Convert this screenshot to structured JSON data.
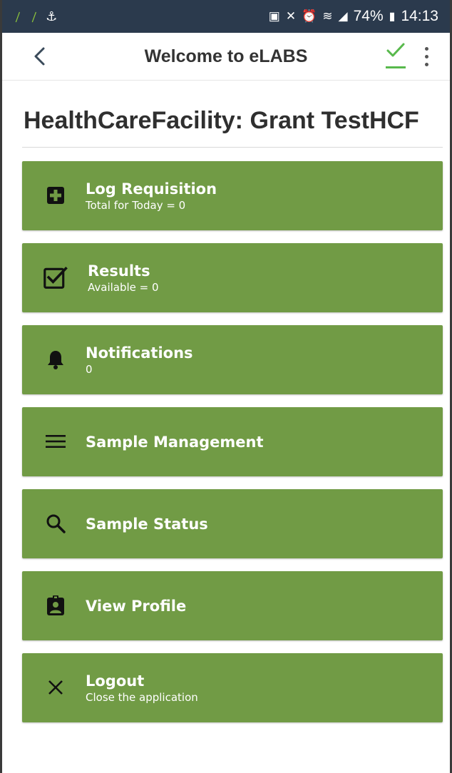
{
  "status_bar": {
    "battery": "74%",
    "time": "14:13"
  },
  "app_bar": {
    "title": "Welcome to eLABS"
  },
  "facility": {
    "heading": "HealthCareFacility: Grant TestHCF"
  },
  "menu": [
    {
      "title": "Log Requisition",
      "subtitle": "Total for Today = 0",
      "icon": "medical-plus-icon"
    },
    {
      "title": "Results",
      "subtitle": "Available = 0",
      "icon": "checkbox-icon"
    },
    {
      "title": "Notifications",
      "subtitle": "0",
      "icon": "bell-icon"
    },
    {
      "title": "Sample Management",
      "subtitle": "",
      "icon": "menu-lines-icon"
    },
    {
      "title": "Sample Status",
      "subtitle": "",
      "icon": "search-icon"
    },
    {
      "title": "View Profile",
      "subtitle": "",
      "icon": "badge-icon"
    },
    {
      "title": "Logout",
      "subtitle": "Close the application",
      "icon": "close-icon"
    }
  ],
  "colors": {
    "card": "#719b45",
    "status_bar": "#2b3a4d",
    "accent_check": "#58b94c"
  }
}
